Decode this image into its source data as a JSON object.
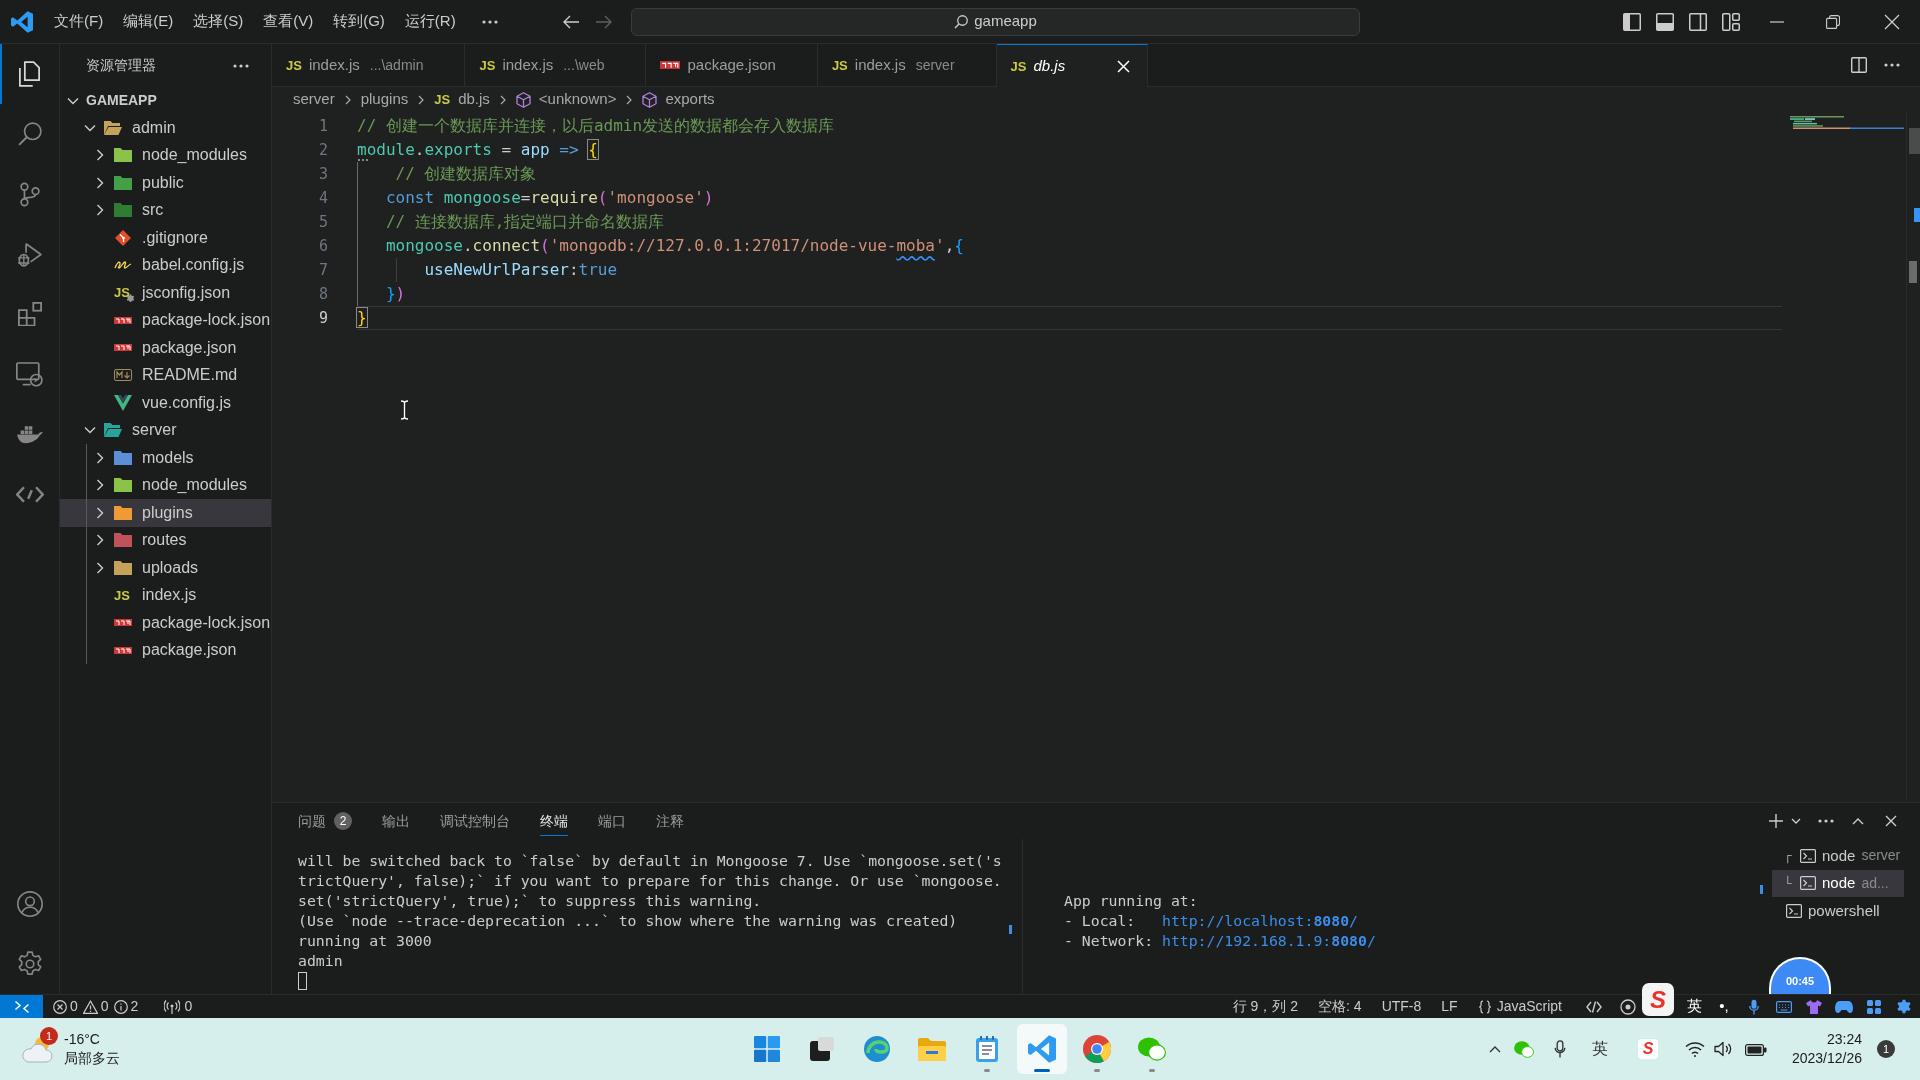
{
  "title_bar": {
    "menu": [
      {
        "label": "文件(F)"
      },
      {
        "label": "编辑(E)"
      },
      {
        "label": "选择(S)"
      },
      {
        "label": "查看(V)"
      },
      {
        "label": "转到(G)"
      },
      {
        "label": "运行(R)"
      }
    ],
    "navigation": {
      "back": {
        "disabled": false
      },
      "forward": {
        "disabled": true
      }
    },
    "search": {
      "value": "gameapp"
    }
  },
  "activity_bar": {
    "items": [
      {
        "selected": true
      },
      {
        "selected": false
      },
      {
        "selected": false
      },
      {
        "selected": false
      },
      {
        "selected": false
      },
      {
        "selected": false
      },
      {
        "selected": false
      },
      {
        "selected": false
      }
    ]
  },
  "sidebar": {
    "title": "资源管理器",
    "root": {
      "label": "GAMEAPP",
      "expanded": true
    },
    "tree": [
      {
        "label": "admin",
        "kind": "folder",
        "color": "#c5a15a",
        "expanded": true,
        "selected": false,
        "children": [
          {
            "label": "node_modules",
            "kind": "folder",
            "color": "#8bc34a",
            "expanded": false,
            "selected": false
          },
          {
            "label": "public",
            "kind": "folder",
            "color": "#43a047",
            "expanded": false,
            "selected": false
          },
          {
            "label": "src",
            "kind": "folder",
            "color": "#2e7d32",
            "expanded": false,
            "selected": false
          },
          {
            "label": ".gitignore",
            "kind": "git",
            "selected": false
          },
          {
            "label": "babel.config.js",
            "kind": "babel",
            "selected": false
          },
          {
            "label": "jsconfig.json",
            "kind": "jsconfig",
            "icon_text": "JS",
            "selected": false
          },
          {
            "label": "package-lock.json",
            "kind": "npm",
            "selected": false
          },
          {
            "label": "package.json",
            "kind": "npm",
            "selected": false
          },
          {
            "label": "README.md",
            "kind": "markdown",
            "selected": false
          },
          {
            "label": "vue.config.js",
            "kind": "vue",
            "selected": false
          }
        ]
      },
      {
        "label": "server",
        "kind": "folder",
        "color": "#26a69a",
        "expanded": true,
        "selected": false,
        "children": [
          {
            "label": "models",
            "kind": "folder",
            "color": "#5c8fd6",
            "expanded": false,
            "selected": false
          },
          {
            "label": "node_modules",
            "kind": "folder",
            "color": "#8bc34a",
            "expanded": false,
            "selected": false
          },
          {
            "label": "plugins",
            "kind": "folder",
            "color": "#f09a36",
            "expanded": false,
            "selected": true
          },
          {
            "label": "routes",
            "kind": "folder",
            "color": "#c2525a",
            "expanded": false,
            "selected": false
          },
          {
            "label": "uploads",
            "kind": "folder",
            "color": "#c5a15a",
            "expanded": false,
            "selected": false
          },
          {
            "label": "index.js",
            "kind": "js",
            "icon_text": "JS",
            "selected": false
          },
          {
            "label": "package-lock.json",
            "kind": "npm",
            "selected": false
          },
          {
            "label": "package.json",
            "kind": "npm",
            "selected": false
          }
        ]
      }
    ]
  },
  "tabs": [
    {
      "kind": "js",
      "icon_text": "JS",
      "label": "index.js",
      "description": "...\\admin",
      "selected": false,
      "preview": false
    },
    {
      "kind": "js",
      "icon_text": "JS",
      "label": "index.js",
      "description": "...\\web",
      "selected": false,
      "preview": false
    },
    {
      "kind": "npm",
      "label": "package.json",
      "selected": false,
      "preview": false
    },
    {
      "kind": "js",
      "icon_text": "JS",
      "label": "index.js",
      "description": "server",
      "selected": false,
      "preview": false
    },
    {
      "kind": "js",
      "icon_text": "JS",
      "label": "db.js",
      "selected": true,
      "preview": true
    }
  ],
  "breadcrumb": [
    {
      "label": "server",
      "kind": "folder"
    },
    {
      "label": "plugins",
      "kind": "folder"
    },
    {
      "label": "db.js",
      "kind": "js",
      "icon_text": "JS"
    },
    {
      "label": "<unknown>",
      "kind": "symbol"
    },
    {
      "label": "exports",
      "kind": "symbol"
    }
  ],
  "editor": {
    "lines": [
      {
        "number": "1",
        "active": false,
        "tokens": [
          {
            "text": "// 创建一个数据库并连接，以后admin发送的数据都会存入数据库",
            "kind": "comment"
          }
        ]
      },
      {
        "number": "2",
        "active": false,
        "tokens": [
          {
            "text": "module",
            "kind": "type"
          },
          {
            "text": ".",
            "kind": "plain"
          },
          {
            "text": "exports",
            "kind": "type"
          },
          {
            "text": " = ",
            "kind": "plain"
          },
          {
            "text": "app",
            "kind": "param"
          },
          {
            "text": " => ",
            "kind": "keyword"
          },
          {
            "text": "{",
            "kind": "match"
          }
        ]
      },
      {
        "number": "3",
        "active": false,
        "tokens": [
          {
            "text": "    // 创建数据库对象",
            "kind": "comment"
          }
        ]
      },
      {
        "number": "4",
        "active": false,
        "tokens": [
          {
            "text": "   const",
            "kind": "keyword"
          },
          {
            "text": " mongoose",
            "kind": "type"
          },
          {
            "text": "=",
            "kind": "plain"
          },
          {
            "text": "require",
            "kind": "func"
          },
          {
            "text": "(",
            "kind": "bracket2"
          },
          {
            "text": "'mongoose'",
            "kind": "string"
          },
          {
            "text": ")",
            "kind": "bracket2"
          }
        ]
      },
      {
        "number": "5",
        "active": false,
        "tokens": [
          {
            "text": "   // 连接数据库,指定端口并命名数据库",
            "kind": "comment"
          }
        ]
      },
      {
        "number": "6",
        "active": false,
        "tokens": [
          {
            "text": "   mongoose",
            "kind": "type"
          },
          {
            "text": ".",
            "kind": "plain"
          },
          {
            "text": "connect",
            "kind": "func"
          },
          {
            "text": "(",
            "kind": "bracket2"
          },
          {
            "text": "'mongodb://127.0.0.1:27017/node-vue-",
            "kind": "string"
          },
          {
            "text": "moba",
            "kind": "flagged"
          },
          {
            "text": "'",
            "kind": "string"
          },
          {
            "text": ",",
            "kind": "plain"
          },
          {
            "text": "{",
            "kind": "bracket3"
          }
        ]
      },
      {
        "number": "7",
        "active": false,
        "tokens": [
          {
            "text": "       useNewUrlParser",
            "kind": "param"
          },
          {
            "text": ":",
            "kind": "plain"
          },
          {
            "text": "true",
            "kind": "keyword"
          }
        ]
      },
      {
        "number": "8",
        "active": false,
        "tokens": [
          {
            "text": "   }",
            "kind": "bracket3"
          },
          {
            "text": ")",
            "kind": "bracket2"
          }
        ]
      },
      {
        "number": "9",
        "active": true,
        "tokens": [
          {
            "text": "}",
            "kind": "match"
          }
        ]
      }
    ]
  },
  "panel": {
    "tabs": [
      {
        "label": "问题",
        "count": "2",
        "selected": false
      },
      {
        "label": "输出",
        "selected": false
      },
      {
        "label": "调试控制台",
        "selected": false
      },
      {
        "label": "终端",
        "selected": true
      },
      {
        "label": "端口",
        "selected": false
      },
      {
        "label": "注释",
        "selected": false
      }
    ],
    "terminal": {
      "lines": [
        "will be switched back to `false` by default in Mongoose 7. Use `mongoose.set('s",
        "trictQuery', false);` if you want to prepare for this change. Or use `mongoose.",
        "set('strictQuery', true);` to suppress this warning.",
        "(Use `node --trace-deprecation ...` to show where the warning was created)",
        "running at 3000",
        "admin"
      ],
      "split": {
        "heading": "App running at:",
        "links": [
          {
            "label": "- Local:",
            "url": "http://localhost:**8080**/"
          },
          {
            "label": "- Network:",
            "url": "http://192.168.1.9:**8080**/"
          }
        ]
      }
    },
    "terminals": [
      {
        "prefix": "┌",
        "label": "node",
        "description": "server",
        "selected": false
      },
      {
        "prefix": "└",
        "label": "node",
        "description": "ad...",
        "selected": true
      },
      {
        "label": "powershell",
        "selected": false
      }
    ]
  },
  "recording_timer": {
    "time": "00:45"
  },
  "status_bar": {
    "problems": {
      "errors": "0",
      "warnings": "0",
      "infos": "2"
    },
    "ports": "0",
    "items": [
      {
        "kind": "text",
        "label": "行 9，列 2"
      },
      {
        "kind": "text",
        "label": "空格: 4"
      },
      {
        "kind": "text",
        "label": "UTF-8"
      },
      {
        "kind": "text",
        "label": "LF"
      },
      {
        "kind": "language",
        "label": "JavaScript"
      }
    ]
  },
  "ime_toolbar": {
    "logo": "S",
    "mode": "英",
    "punctuation": "•,"
  },
  "taskbar": {
    "weather": {
      "alerts": "1",
      "temperature": "-16°C",
      "condition": "局部多云"
    },
    "apps": [
      {
        "running": false,
        "active": false
      },
      {
        "running": false,
        "active": false
      },
      {
        "running": false,
        "active": false
      },
      {
        "running": false,
        "active": false
      },
      {
        "running": true,
        "active": false
      },
      {
        "running": true,
        "active": true
      },
      {
        "running": true,
        "active": false
      },
      {
        "running": true,
        "active": false
      }
    ],
    "tray": {
      "input_mode": "英",
      "ime_logo": "S"
    },
    "clock": {
      "time": "23:24",
      "date": "2023/12/26"
    },
    "notifications": "1"
  }
}
